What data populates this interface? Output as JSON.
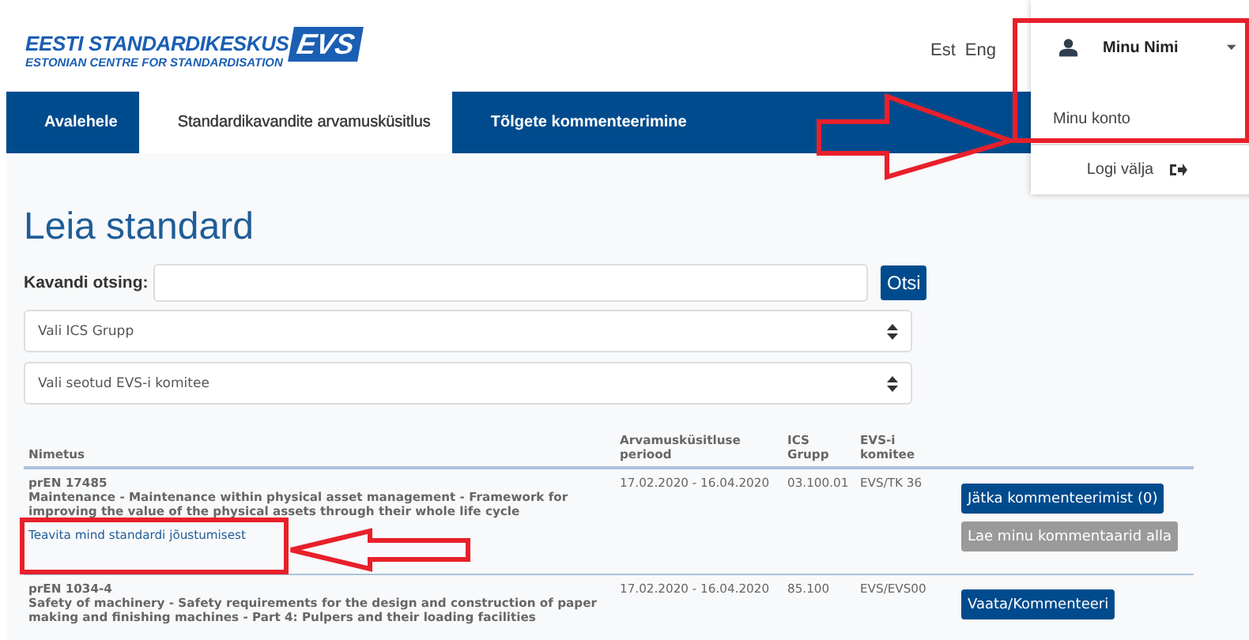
{
  "logo": {
    "title": "EESTI STANDARDIKESKUS",
    "mark": "EVS",
    "subtitle": "ESTONIAN CENTRE FOR STANDARDISATION"
  },
  "languages": [
    {
      "label": "Est"
    },
    {
      "label": "Eng"
    }
  ],
  "nav": [
    {
      "label": "Avalehele",
      "selected": false
    },
    {
      "label": "Standardikavandite arvamusküsitlus",
      "selected": true
    },
    {
      "label": "Tõlgete kommenteerimine",
      "selected": false
    }
  ],
  "user_menu": {
    "name": "Minu Nimi",
    "expanded": true,
    "items": [
      {
        "label": "Minu konto",
        "kind": "link"
      },
      {
        "label": "Logi välja",
        "kind": "logout"
      }
    ]
  },
  "page_title": "Leia standard",
  "search": {
    "label": "Kavandi otsing:",
    "button": "Otsi"
  },
  "filters": [
    {
      "placeholder": "Vali ICS Grupp"
    },
    {
      "placeholder": "Vali seotud EVS-i komitee"
    }
  ],
  "table": {
    "columns": [
      "Nimetus",
      "Arvamusküsitluse periood",
      "ICS Grupp",
      "EVS-i komitee"
    ],
    "rows": [
      {
        "code": "prEN 17485",
        "title": "Maintenance - Maintenance within physical asset management - Framework for improving the value of the physical assets through their whole life cycle",
        "link": "Teavita mind standardi jõustumisest",
        "period": "17.02.2020 - 16.04.2020",
        "ics": "03.100.01",
        "committee": "EVS/TK 36",
        "buttons": [
          {
            "label": "Jätka kommenteerimist (0)",
            "disabled": false
          },
          {
            "label": "Lae minu kommentaarid alla",
            "disabled": true
          }
        ]
      },
      {
        "code": "prEN 1034-4",
        "title": "Safety of machinery - Safety requirements for the design and construction of paper making and finishing machines - Part 4: Pulpers and their loading facilities",
        "period": "17.02.2020 - 16.04.2020",
        "ics": "85.100",
        "committee": "EVS/EVS00",
        "buttons": [
          {
            "label": "Vaata/Kommenteeri",
            "disabled": false
          }
        ]
      }
    ]
  }
}
